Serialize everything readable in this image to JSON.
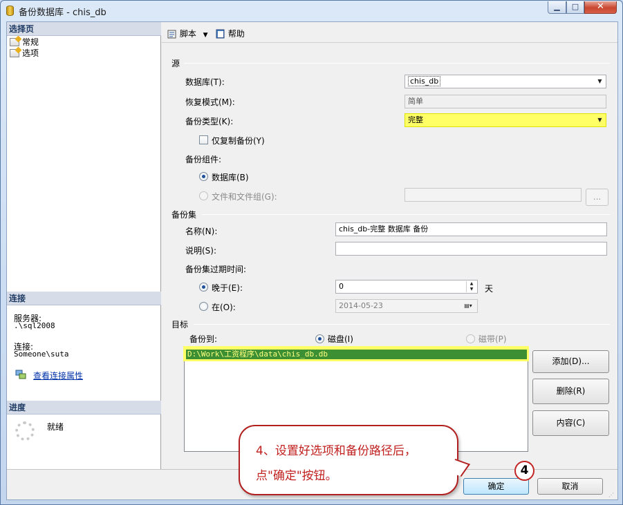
{
  "window": {
    "title": "备份数据库 - chis_db",
    "min_label": "▁",
    "max_label": "□",
    "close_label": "✕"
  },
  "left": {
    "select_page_header": "选择页",
    "pages": [
      "常规",
      "选项"
    ],
    "connection_header": "连接",
    "server_label": "服务器:",
    "server_value": ".\\sql2008",
    "connection_label": "连接:",
    "connection_value": "Someone\\suta",
    "view_props_link": "查看连接属性",
    "progress_header": "进度",
    "progress_status": "就绪"
  },
  "toolbar": {
    "script_label": "脚本",
    "help_label": "帮助"
  },
  "source": {
    "title": "源",
    "database_label": "数据库(T):",
    "database_value": "chis_db",
    "recovery_label": "恢复模式(M):",
    "recovery_value": "简单",
    "backup_type_label": "备份类型(K):",
    "backup_type_value": "完整",
    "copy_only_label": "仅复制备份(Y)",
    "component_label": "备份组件:",
    "component_db_label": "数据库(B)",
    "component_files_label": "文件和文件组(G):",
    "ellipsis_label": "..."
  },
  "backup_set": {
    "title": "备份集",
    "name_label": "名称(N):",
    "name_value": "chis_db-完整 数据库 备份",
    "desc_label": "说明(S):",
    "desc_value": "",
    "expire_label": "备份集过期时间:",
    "after_label": "晚于(E):",
    "after_value": "0",
    "days_label": "天",
    "on_label": "在(O):",
    "on_value": "2014-05-23"
  },
  "destination": {
    "title": "目标",
    "backup_to_label": "备份到:",
    "disk_label": "磁盘(I)",
    "tape_label": "磁带(P)",
    "paths": [
      "D:\\Work\\工资程序\\data\\chis_db.db"
    ],
    "add_button": "添加(D)...",
    "remove_button": "删除(R)",
    "contents_button": "内容(C)"
  },
  "footer": {
    "ok_button": "确定",
    "cancel_button": "取消"
  },
  "annotation": {
    "line1": "4、设置好选项和备份路径后，",
    "line2": "点\"确定\"按钮。",
    "badge": "4"
  },
  "colors": {
    "highlight": "#ffff66",
    "path_row": "#3c8f32",
    "callout_border": "#b21f1f"
  }
}
